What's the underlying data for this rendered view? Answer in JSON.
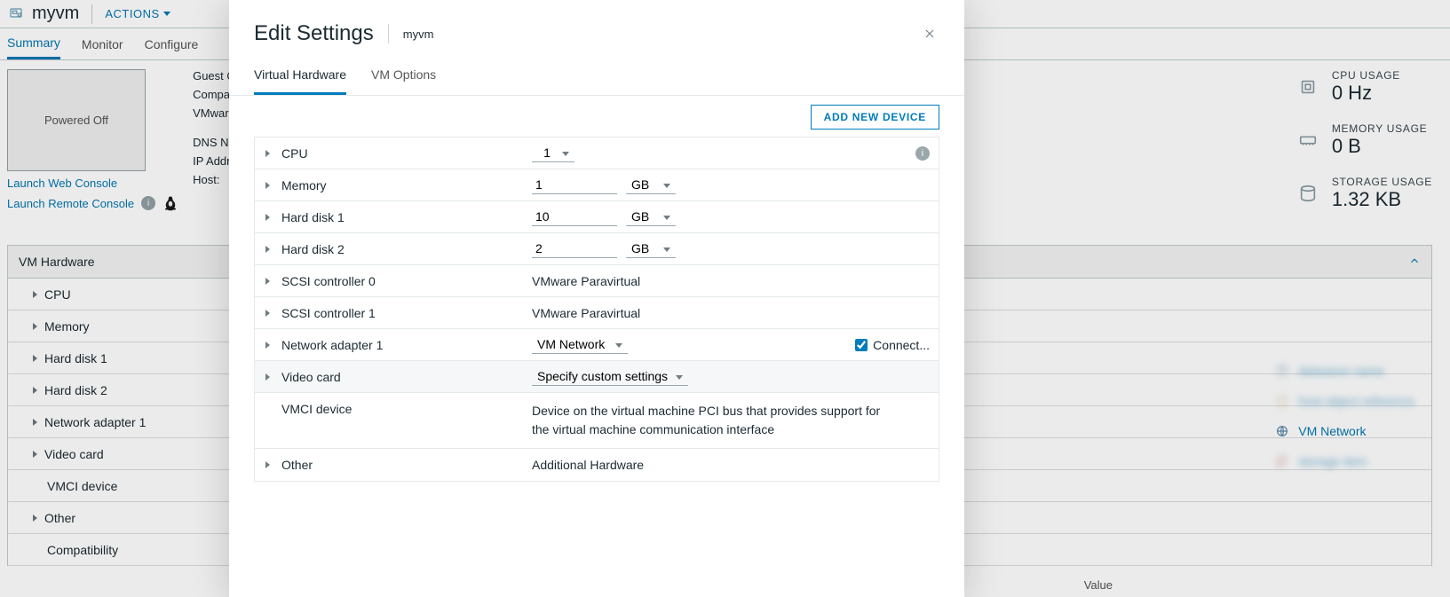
{
  "header": {
    "vm_name": "myvm",
    "actions_label": "ACTIONS"
  },
  "tabs": [
    "Summary",
    "Monitor",
    "Configure"
  ],
  "active_tab_index": 0,
  "console": {
    "state": "Powered Off",
    "launch_web": "Launch Web Console",
    "launch_remote": "Launch Remote Console"
  },
  "meta": {
    "guest_os_label": "Guest OS:",
    "compatibility_label": "Compatibility",
    "vmware_tools_label": "VMware Tool",
    "dns_label": "DNS Name:",
    "ip_label": "IP Addresses",
    "host_label": "Host:"
  },
  "usage": [
    {
      "label": "CPU USAGE",
      "value": "0 Hz"
    },
    {
      "label": "MEMORY USAGE",
      "value": "0 B"
    },
    {
      "label": "STORAGE USAGE",
      "value": "1.32 KB"
    }
  ],
  "hw_panel": {
    "title": "VM Hardware",
    "rows": [
      "CPU",
      "Memory",
      "Hard disk 1",
      "Hard disk 2",
      "Network adapter 1",
      "Video card",
      "VMCI device",
      "Other",
      "Compatibility"
    ]
  },
  "right_links": {
    "network": "VM Network"
  },
  "bottom_col": "Value",
  "modal": {
    "title": "Edit Settings",
    "subtitle": "myvm",
    "tabs": [
      "Virtual Hardware",
      "VM Options"
    ],
    "active_tab_index": 0,
    "add_btn": "ADD NEW DEVICE",
    "rows": {
      "cpu": {
        "label": "CPU",
        "value": "1"
      },
      "memory": {
        "label": "Memory",
        "value": "1",
        "unit": "GB"
      },
      "hd1": {
        "label": "Hard disk 1",
        "value": "10",
        "unit": "GB"
      },
      "hd2": {
        "label": "Hard disk 2",
        "value": "2",
        "unit": "GB"
      },
      "scsi0": {
        "label": "SCSI controller 0",
        "text": "VMware Paravirtual"
      },
      "scsi1": {
        "label": "SCSI controller 1",
        "text": "VMware Paravirtual"
      },
      "net1": {
        "label": "Network adapter 1",
        "value": "VM Network",
        "connect_label": "Connect..."
      },
      "video": {
        "label": "Video card",
        "value": "Specify custom settings"
      },
      "vmci": {
        "label": "VMCI device",
        "text": "Device on the virtual machine PCI bus that provides support for the virtual machine communication interface"
      },
      "other": {
        "label": "Other",
        "text": "Additional Hardware"
      }
    }
  }
}
